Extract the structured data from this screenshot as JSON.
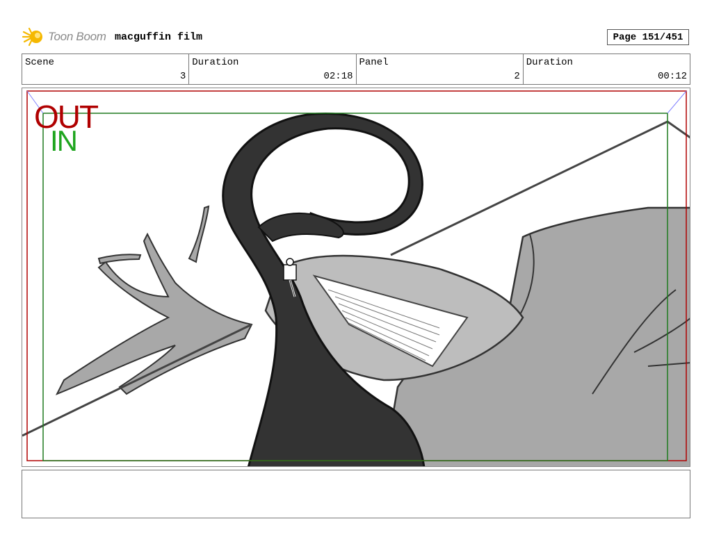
{
  "header": {
    "logo_text": "Toon Boom",
    "film_title": "macguffin film",
    "page": "Page 151/451"
  },
  "info": {
    "scene_label": "Scene",
    "scene_value": "3",
    "duration_label": "Duration",
    "duration_value": "02:18",
    "panel_label": "Panel",
    "panel_value": "2",
    "panel_duration_label": "Duration",
    "panel_duration_value": "00:12"
  },
  "panel": {
    "out_label": "OUT",
    "in_label": "IN",
    "colors": {
      "out_frame": "#b00000",
      "in_frame": "#1f7a1f",
      "accent": "#f5b800"
    }
  },
  "notes": {
    "text": ""
  }
}
